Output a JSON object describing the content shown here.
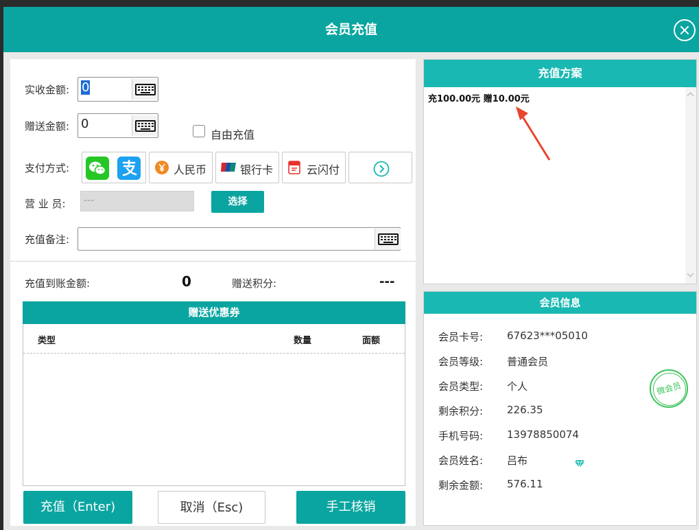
{
  "dialog": {
    "title": "会员充值"
  },
  "form": {
    "received_label": "实收金额:",
    "received_value": "0",
    "gift_label": "赠送金额:",
    "gift_value": "0",
    "free_recharge_label": "自由充值",
    "free_recharge_checked": false,
    "payment_label": "支付方式:",
    "payment_methods": [
      "人民币",
      "银行卡",
      "云闪付"
    ],
    "clerk_label": "营  业 员:",
    "clerk_value": "---",
    "select_label": "选择",
    "remark_label": "充值备注:",
    "remark_value": ""
  },
  "summary": {
    "credited_label": "充值到账金额:",
    "credited_value": "0",
    "points_label": "赠送积分:",
    "points_value": "---"
  },
  "coupons": {
    "title": "赠送优惠券",
    "columns": [
      "类型",
      "数量",
      "面额"
    ],
    "rows": []
  },
  "actions": {
    "recharge": "充值（Enter)",
    "cancel": "取消（Esc)",
    "manual": "手工核销"
  },
  "plans": {
    "title": "充值方案",
    "items": [
      "充100.00元 赠10.00元"
    ]
  },
  "member": {
    "title": "会员信息",
    "stamp_text": "微会员",
    "fields": [
      {
        "label": "会员卡号:",
        "value": "67623***05010"
      },
      {
        "label": "会员等级:",
        "value": "普通会员"
      },
      {
        "label": "会员类型:",
        "value": "个人"
      },
      {
        "label": "剩余积分:",
        "value": "226.35"
      },
      {
        "label": "手机号码:",
        "value": "13978850074"
      },
      {
        "label": "会员姓名:",
        "value": "吕布"
      },
      {
        "label": "剩余金额:",
        "value": "576.11"
      }
    ]
  },
  "colors": {
    "accent": "#0aa5a0",
    "panel_head": "#19b8b2",
    "wechat": "#27c627",
    "alipay": "#1ea1f1",
    "rmb": "#f08a24",
    "annotation_arrow": "#e8452c"
  }
}
